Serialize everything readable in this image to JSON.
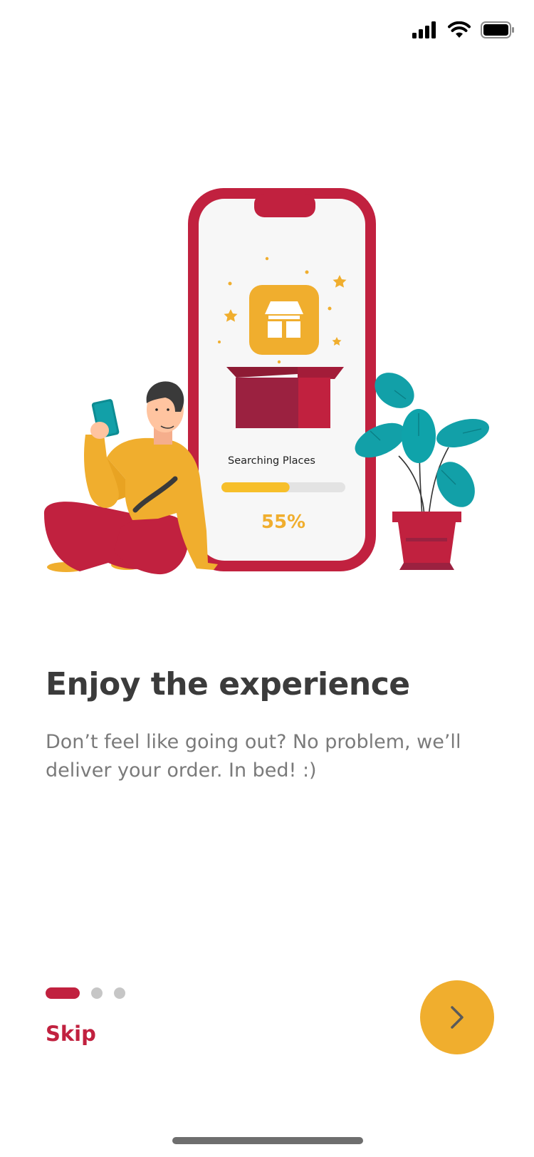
{
  "colors": {
    "accent": "#C1213F",
    "secondary": "#F0AE2E",
    "title": "#3B3B3B",
    "body_text": "#7A7A7A",
    "teal": "#12A0A8"
  },
  "status_bar": {
    "icons": [
      "cellular-signal-icon",
      "wifi-icon",
      "battery-icon"
    ]
  },
  "illustration": {
    "icon": "store-icon",
    "label": "Searching Places",
    "progress": 55,
    "progress_text": "55%"
  },
  "onboarding": {
    "title": "Enjoy the experience",
    "description": "Don’t feel like going out? No problem, we’ll deliver your order. In bed! :)",
    "page_count": 3,
    "current_page": 1,
    "skip_label": "Skip",
    "next_icon": "chevron-right-icon"
  }
}
